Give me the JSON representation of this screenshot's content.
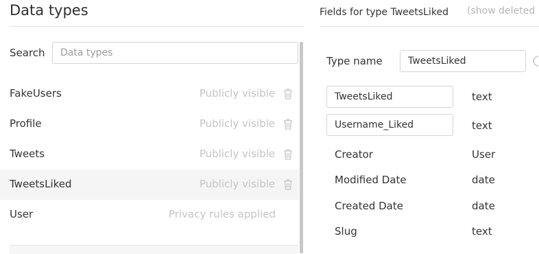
{
  "left_panel": {
    "title": "Data types",
    "search_label": "Search",
    "search_placeholder": "Data types",
    "data_types": [
      {
        "name": "FakeUsers",
        "visibility": "Publicly visible"
      },
      {
        "name": "Profile",
        "visibility": "Publicly visible"
      },
      {
        "name": "Tweets",
        "visibility": "Publicly visible"
      },
      {
        "name": "TweetsLiked",
        "visibility": "Publicly visible"
      },
      {
        "name": "User",
        "visibility": "Privacy rules applied"
      }
    ]
  },
  "right_panel": {
    "title": "Fields for type TweetsLiked",
    "show_deleted": "(show deleted",
    "type_name_label": "Type name",
    "type_name_value": "TweetsLiked",
    "custom_fields": [
      {
        "name": "TweetsLiked",
        "type": "text"
      },
      {
        "name": "Username_Liked",
        "type": "text"
      }
    ],
    "builtin_fields": [
      {
        "name": "Creator",
        "type": "User"
      },
      {
        "name": "Modified Date",
        "type": "date"
      },
      {
        "name": "Created Date",
        "type": "date"
      },
      {
        "name": "Slug",
        "type": "text"
      }
    ]
  },
  "colors": {
    "muted_text": "#c4c4c4",
    "selected_row": "#f5f5f5",
    "border": "#d4d4d4"
  }
}
